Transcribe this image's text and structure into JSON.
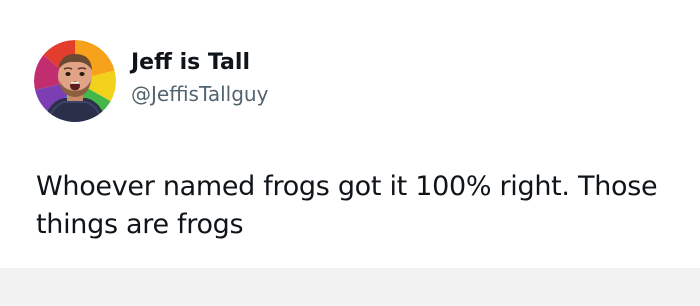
{
  "tweet": {
    "author": {
      "display_name": "Jeff is Tall",
      "handle": "@JeffisTallguy",
      "avatar_icon": "profile-photo"
    },
    "text": "Whoever named frogs got it 100% right. Those things are frogs"
  },
  "colors": {
    "name": "#0f1419",
    "handle": "#536471",
    "background": "#ffffff"
  }
}
